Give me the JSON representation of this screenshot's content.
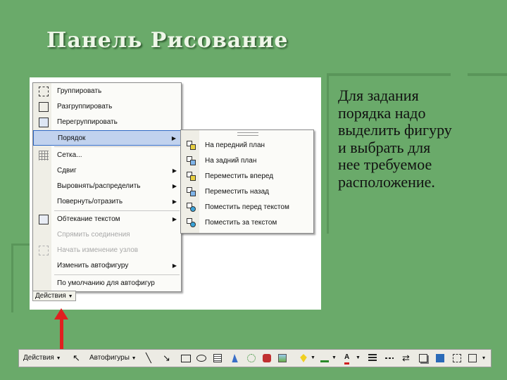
{
  "slide": {
    "title": "Панель Рисование",
    "body_lines": [
      "Для задания",
      "порядка надо",
      "выделить фигуру",
      "и выбрать для",
      "нее требуемое",
      "расположение."
    ]
  },
  "actions_menu": {
    "button_label": "Действия",
    "items": [
      {
        "label": "Группировать"
      },
      {
        "label": "Разгруппировать"
      },
      {
        "label": "Перегруппировать"
      },
      {
        "label": "Порядок"
      },
      {
        "label": "Сетка..."
      },
      {
        "label": "Сдвиг"
      },
      {
        "label": "Выровнять/распределить"
      },
      {
        "label": "Повернуть/отразить"
      },
      {
        "label": "Обтекание текстом"
      },
      {
        "label": "Спрямить соединения"
      },
      {
        "label": "Начать изменение узлов"
      },
      {
        "label": "Изменить автофигуру"
      },
      {
        "label": "По умолчанию для автофигур"
      }
    ]
  },
  "order_submenu": {
    "items": [
      {
        "label": "На передний план"
      },
      {
        "label": "На задний план"
      },
      {
        "label": "Переместить вперед"
      },
      {
        "label": "Переместить назад"
      },
      {
        "label": "Поместить перед текстом"
      },
      {
        "label": "Поместить за текстом"
      }
    ]
  },
  "drawing_toolbar": {
    "actions_label": "Действия",
    "autoshapes_label": "Автофигуры"
  },
  "colors": {
    "slide_background": "#6aaa6a",
    "highlight": "#c1d2ee",
    "arrow": "#e02020"
  }
}
